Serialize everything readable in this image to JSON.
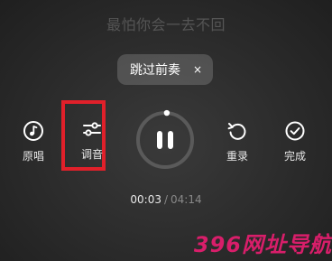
{
  "lyric_text": "最怕你会一去不回",
  "skip_intro": {
    "label": "跳过前奏",
    "close_glyph": "×"
  },
  "controls": {
    "original": {
      "label": "原唱",
      "icon": "music-note-icon"
    },
    "tune": {
      "label": "调音",
      "icon": "sliders-icon"
    },
    "pause": {
      "icon": "pause-icon",
      "progress_fraction": 0.01
    },
    "rerecord": {
      "label": "重录",
      "icon": "rerecord-icon"
    },
    "finish": {
      "label": "完成",
      "icon": "check-circle-icon"
    }
  },
  "time": {
    "current": "00:03",
    "separator": "/",
    "total": "04:14"
  },
  "watermark": "396网址导航",
  "colors": {
    "highlight": "#e0202a",
    "watermark": "#d81e6a"
  }
}
